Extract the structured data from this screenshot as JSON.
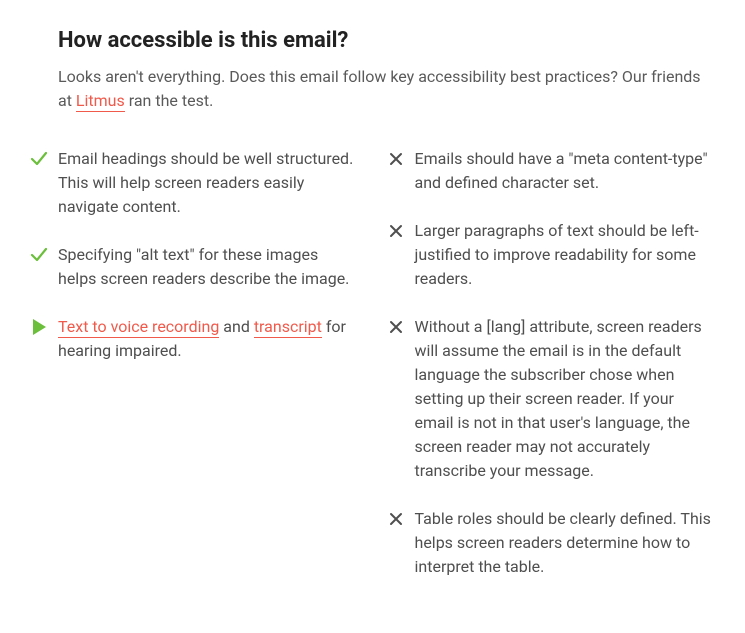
{
  "header": {
    "title": "How accessible is this email?",
    "subtitle_before": "Looks aren't everything. Does this email follow key accessibility best practices? Our friends at ",
    "subtitle_link": "Litmus",
    "subtitle_after": " ran the test."
  },
  "left_items": [
    {
      "icon": "check",
      "text": "Email headings should be well structured. This will help screen readers easily navigate content."
    },
    {
      "icon": "check",
      "text": "Specifying \"alt text\" for these images helps screen readers describe the image."
    },
    {
      "icon": "play",
      "link1": "Text to voice recording",
      "mid": " and ",
      "link2": "transcript",
      "after": " for hearing impaired."
    }
  ],
  "right_items": [
    {
      "icon": "x",
      "text": "Emails should have a \"meta content-type\" and defined character set."
    },
    {
      "icon": "x",
      "text": "Larger paragraphs of text should be left-justified to improve readability for some readers."
    },
    {
      "icon": "x",
      "text": "Without a [lang] attribute, screen readers will assume the email is in the default language the subscriber chose when setting up their screen reader. If your email is not in that user's language, the screen reader may not accurately transcribe your message."
    },
    {
      "icon": "x",
      "text": "Table roles should be clearly defined. This helps screen readers determine how to interpret the table."
    }
  ]
}
